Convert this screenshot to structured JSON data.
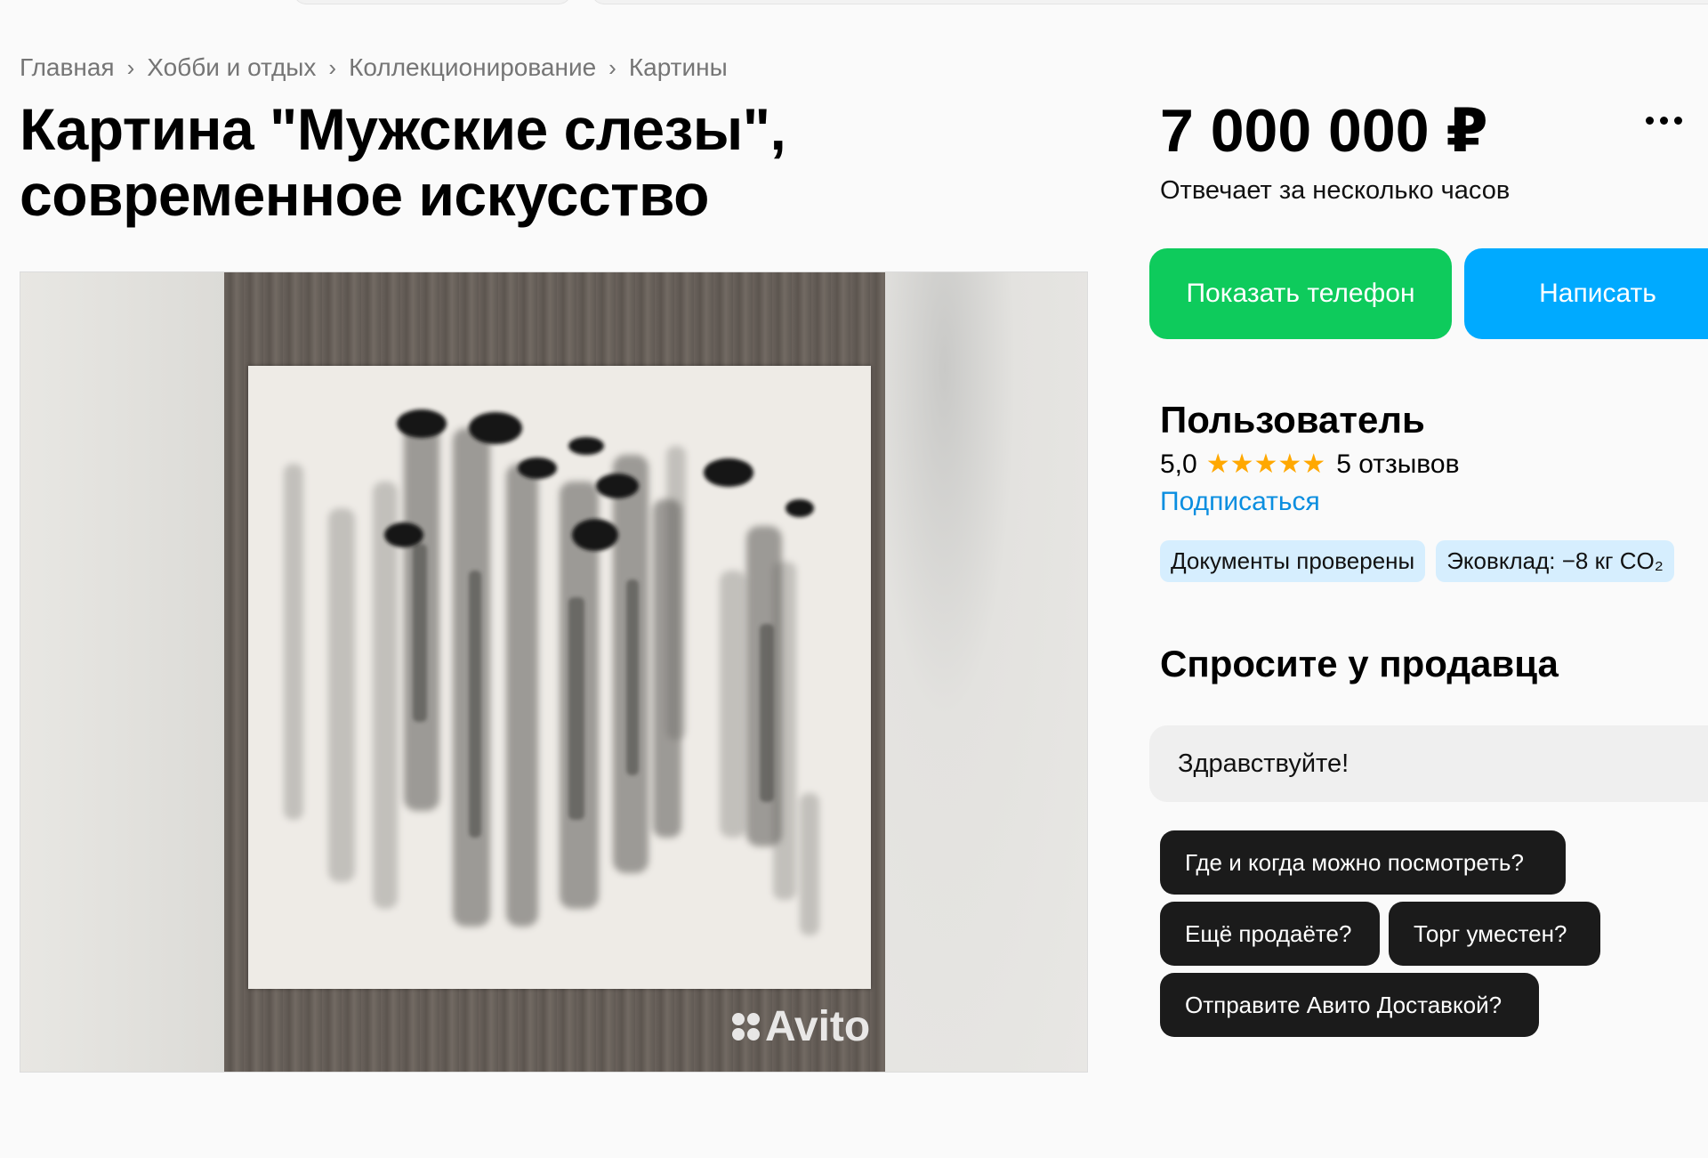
{
  "breadcrumb": [
    "Главная",
    "Хобби и отдых",
    "Коллекционирование",
    "Картины"
  ],
  "listing": {
    "title_line1": "Картина \"Мужские слезы\",",
    "title_line2": "современное искусство",
    "price": "7 000 000 ₽",
    "reply_time": "Отвечает за несколько часов"
  },
  "actions": {
    "show_phone": "Показать телефон",
    "write": "Написать"
  },
  "seller": {
    "name": "Пользователь",
    "rating": "5,0",
    "stars": "★★★★★",
    "reviews": "5 отзывов",
    "subscribe": "Подписаться",
    "badges": [
      "Документы проверены",
      "Эковклад: −8 кг CO₂"
    ]
  },
  "ask": {
    "title": "Спросите у продавца",
    "message": "Здравствуйте!",
    "suggestions": [
      "Где и когда можно посмотреть?",
      "Ещё продаёте?",
      "Торг уместен?",
      "Отправите Авито Доставкой?"
    ]
  },
  "gallery": {
    "watermark": "Avito"
  },
  "colors": {
    "phone_button": "#0ecb5c",
    "write_button": "#00aaff",
    "link": "#0a8ee0",
    "star": "#ffa800",
    "badge_bg": "#d6eefe"
  }
}
